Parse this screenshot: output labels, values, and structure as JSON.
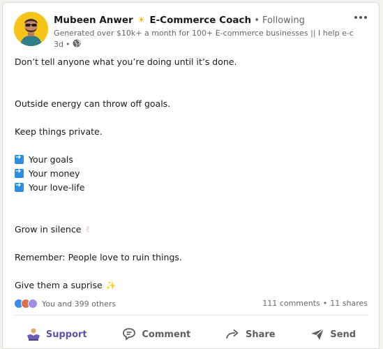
{
  "post": {
    "author": {
      "name": "Mubeen Anwer",
      "title": "E-Commerce Coach",
      "separator": "•",
      "following": "Following",
      "headline": "Generated over $10k+ a month for 100+ E-commerce businesses || I help e-c...",
      "age": "3d",
      "dot": "•"
    },
    "body": {
      "line1": "Don’t tell anyone what you’re doing until it’s done.",
      "line2": "Outside energy can throw off goals.",
      "line3": "Keep things private.",
      "list": [
        "Your goals",
        "Your money",
        "Your love-life"
      ],
      "line4": "Grow in silence",
      "line4_emoji": "✌",
      "line5": "Remember: People love to ruin things.",
      "line6": "Give them a suprise",
      "line6_emoji": "✨"
    },
    "reactions": {
      "summary": "You and 399 others",
      "types": [
        "like",
        "love",
        "insightful"
      ]
    },
    "stats": {
      "comments": "111 comments",
      "dot": "•",
      "shares": "11 shares"
    },
    "actions": {
      "support": "Support",
      "comment": "Comment",
      "share": "Share",
      "send": "Send"
    }
  },
  "colors": {
    "accent": "#5b52b0",
    "avatar_bg": "#f6c419",
    "arrow_box": "#2a8ee7"
  }
}
